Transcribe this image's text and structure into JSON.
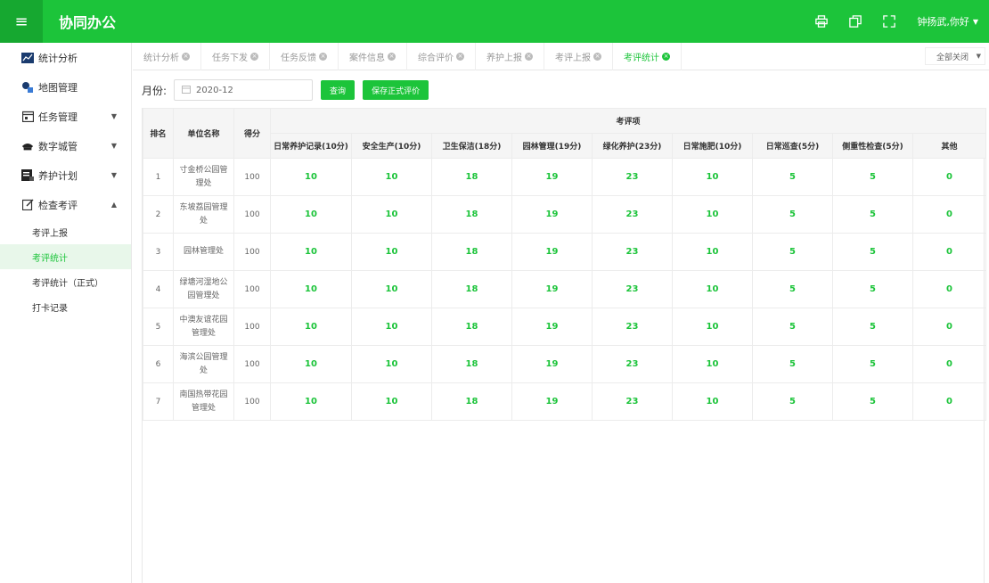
{
  "app": {
    "title": "协同办公",
    "user": "钟扬武,你好"
  },
  "sidebar": {
    "items": [
      {
        "label": "统计分析",
        "icon": "chart-icon"
      },
      {
        "label": "地图管理",
        "icon": "map-icon"
      },
      {
        "label": "任务管理",
        "icon": "task-icon"
      },
      {
        "label": "数字城管",
        "icon": "police-cap-icon"
      },
      {
        "label": "养护计划",
        "icon": "plan-icon"
      },
      {
        "label": "检查考评",
        "icon": "edit-icon"
      }
    ],
    "subitems": [
      {
        "label": "考评上报"
      },
      {
        "label": "考评统计"
      },
      {
        "label": "考评统计（正式）"
      },
      {
        "label": "打卡记录"
      }
    ]
  },
  "tabs": [
    {
      "label": "统计分析"
    },
    {
      "label": "任务下发"
    },
    {
      "label": "任务反馈"
    },
    {
      "label": "案件信息"
    },
    {
      "label": "综合评价"
    },
    {
      "label": "养护上报"
    },
    {
      "label": "考评上报"
    },
    {
      "label": "考评统计"
    }
  ],
  "close_all": "全部关闭",
  "filter": {
    "label": "月份:",
    "month": "2020-12",
    "query_button": "查询",
    "save_button": "保存正式评价"
  },
  "table": {
    "headers": {
      "rank": "排名",
      "unit": "单位名称",
      "score": "得分",
      "group": "考评项",
      "items": [
        "日常养护记录(10分)",
        "安全生产(10分)",
        "卫生保洁(18分)",
        "园林管理(19分)",
        "绿化养护(23分)",
        "日常施肥(10分)",
        "日常巡查(5分)",
        "侧重性检查(5分)",
        "其他"
      ]
    },
    "rows": [
      {
        "rank": "1",
        "unit": "寸金桥公园管理处",
        "score": "100",
        "values": [
          "10",
          "10",
          "18",
          "19",
          "23",
          "10",
          "5",
          "5",
          "0"
        ]
      },
      {
        "rank": "2",
        "unit": "东坡荔园管理处",
        "score": "100",
        "values": [
          "10",
          "10",
          "18",
          "19",
          "23",
          "10",
          "5",
          "5",
          "0"
        ]
      },
      {
        "rank": "3",
        "unit": "园林管理处",
        "score": "100",
        "values": [
          "10",
          "10",
          "18",
          "19",
          "23",
          "10",
          "5",
          "5",
          "0"
        ]
      },
      {
        "rank": "4",
        "unit": "绿塘河湿地公园管理处",
        "score": "100",
        "values": [
          "10",
          "10",
          "18",
          "19",
          "23",
          "10",
          "5",
          "5",
          "0"
        ]
      },
      {
        "rank": "5",
        "unit": "中澳友谊花园管理处",
        "score": "100",
        "values": [
          "10",
          "10",
          "18",
          "19",
          "23",
          "10",
          "5",
          "5",
          "0"
        ]
      },
      {
        "rank": "6",
        "unit": "海滨公园管理处",
        "score": "100",
        "values": [
          "10",
          "10",
          "18",
          "19",
          "23",
          "10",
          "5",
          "5",
          "0"
        ]
      },
      {
        "rank": "7",
        "unit": "南国热带花园管理处",
        "score": "100",
        "values": [
          "10",
          "10",
          "18",
          "19",
          "23",
          "10",
          "5",
          "5",
          "0"
        ]
      }
    ]
  },
  "colors": {
    "primary": "#1cc43a",
    "primary_dark": "#16a830"
  }
}
